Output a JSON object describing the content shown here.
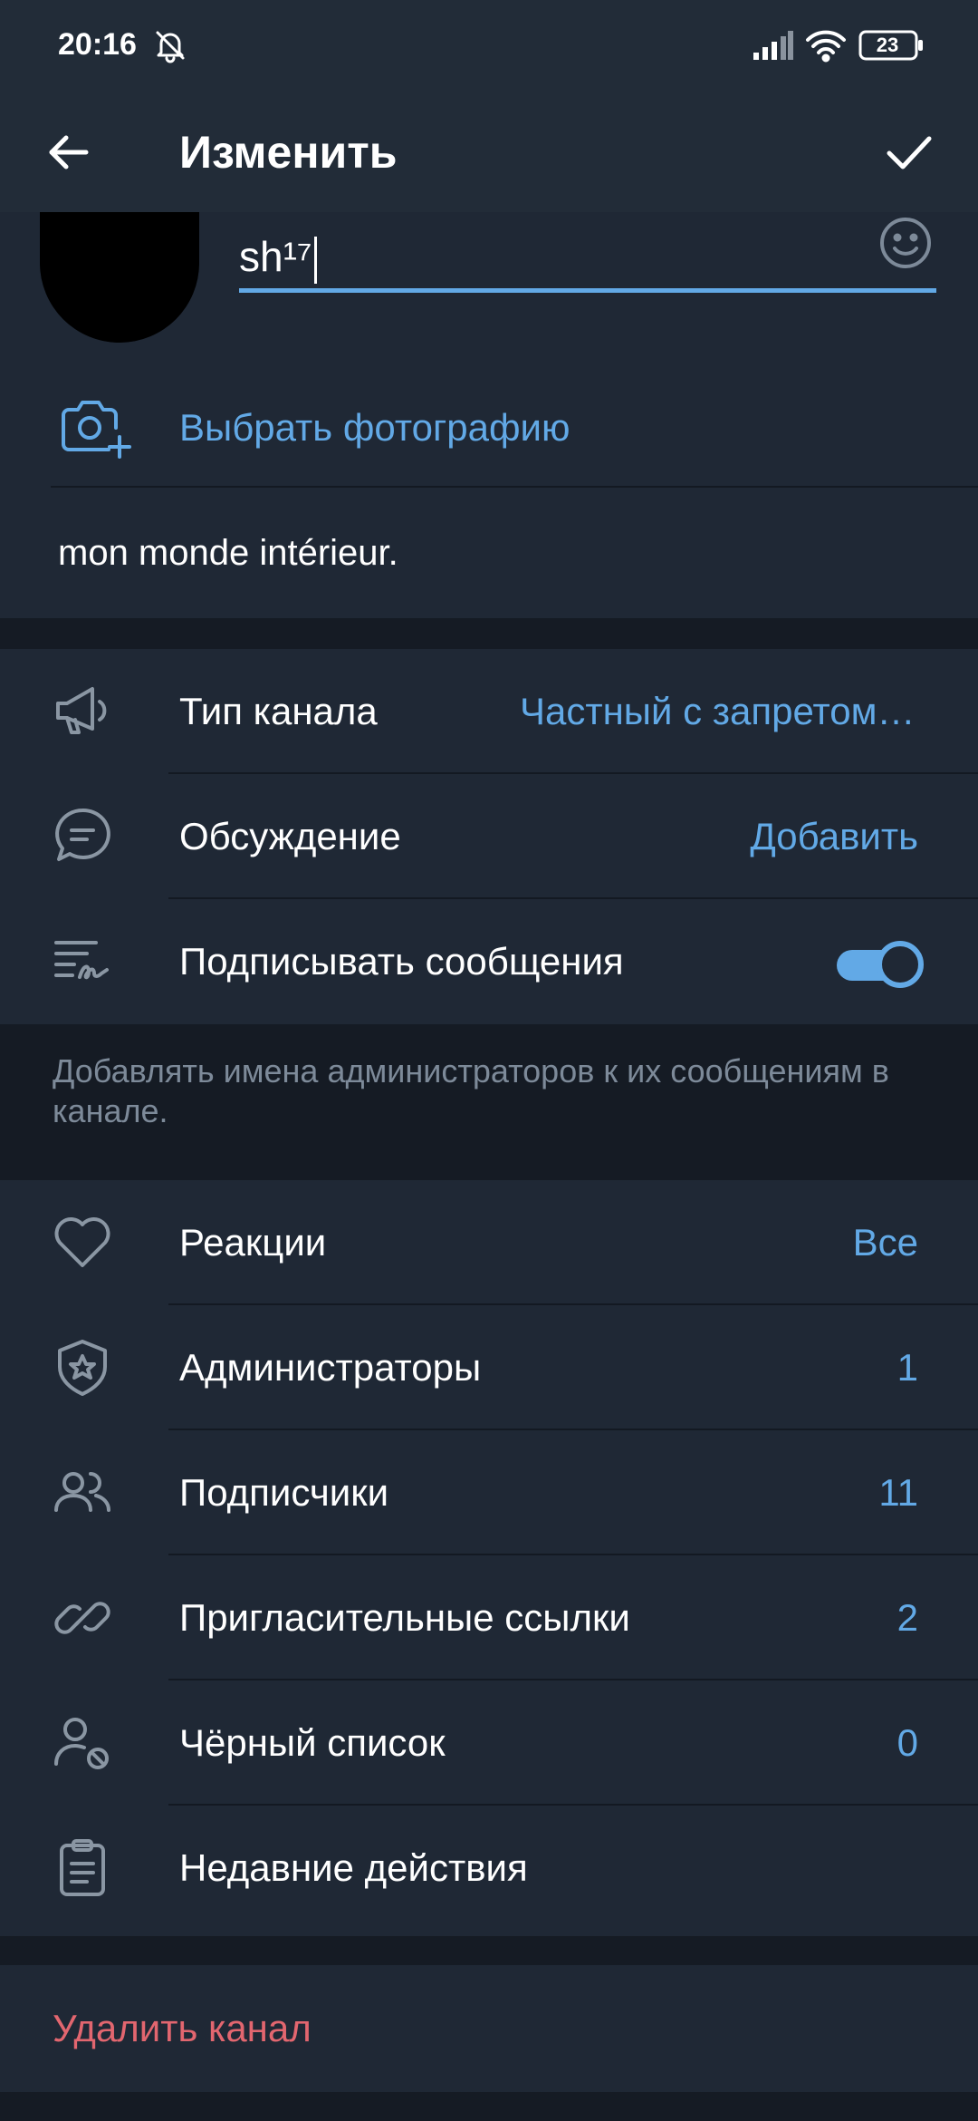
{
  "status_bar": {
    "time": "20:16",
    "battery": "23",
    "icons": [
      "bell-off-icon",
      "signal-icon",
      "wifi-icon",
      "battery-icon"
    ]
  },
  "app_bar": {
    "title": "Изменить",
    "back_icon": "arrow-left-icon",
    "confirm_icon": "check-icon"
  },
  "profile": {
    "name_value": "sh¹⁷",
    "emoji_icon": "smile-icon",
    "choose_photo_label": "Выбрать фотографию",
    "description": "mon monde intérieur."
  },
  "settings_group1": {
    "items": [
      {
        "label": "Тип канала",
        "value": "Частный с запретом копирования",
        "icon": "megaphone-icon"
      },
      {
        "label": "Обсуждение",
        "value": "Добавить",
        "icon": "chat-bubble-icon"
      },
      {
        "label": "Подписывать сообщения",
        "icon": "signature-icon",
        "toggle_on": true
      }
    ],
    "footnote": "Добавлять имена администраторов к их сообщениям в канале."
  },
  "settings_group2": {
    "items": [
      {
        "label": "Реакции",
        "value": "Все",
        "icon": "heart-icon"
      },
      {
        "label": "Администраторы",
        "value": "1",
        "icon": "shield-star-icon"
      },
      {
        "label": "Подписчики",
        "value": "11",
        "icon": "users-icon"
      },
      {
        "label": "Пригласительные ссылки",
        "value": "2",
        "icon": "link-icon"
      },
      {
        "label": "Чёрный список",
        "value": "0",
        "icon": "user-block-icon"
      },
      {
        "label": "Недавние действия",
        "value": "",
        "icon": "clipboard-icon"
      }
    ]
  },
  "danger": {
    "delete_label": "Удалить канал"
  },
  "colors": {
    "accent": "#62a9e6",
    "danger": "#e2666f",
    "surface": "#1f2835",
    "background": "#151b24",
    "header": "#222c38",
    "muted_text": "#7d8a99"
  }
}
